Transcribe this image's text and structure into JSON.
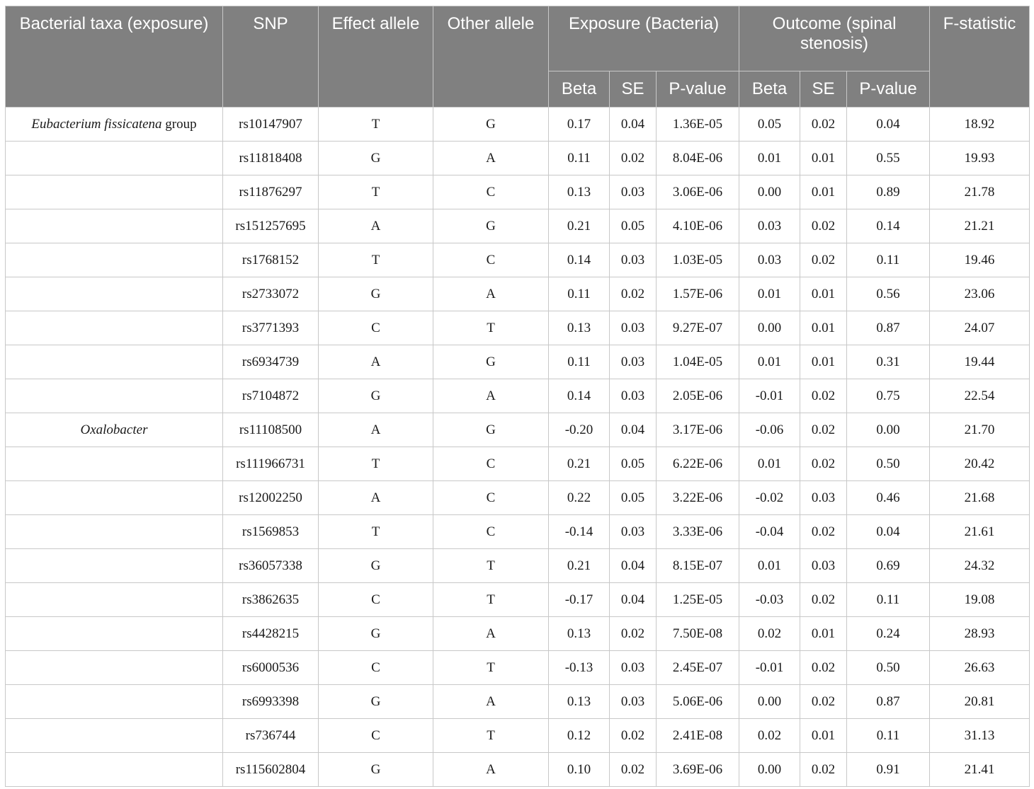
{
  "headers": {
    "taxa": "Bacterial taxa (exposure)",
    "snp": "SNP",
    "effect_allele": "Effect allele",
    "other_allele": "Other allele",
    "exposure": "Exposure (Bacteria)",
    "outcome": "Outcome (spinal stenosis)",
    "fstat": "F-statistic",
    "beta": "Beta",
    "se": "SE",
    "pvalue": "P-value"
  },
  "rows": [
    {
      "taxon_italic": "Eubacterium fissicatena",
      "taxon_suffix": " group",
      "snp": "rs10147907",
      "ea": "T",
      "oa": "G",
      "exp_beta": "0.17",
      "exp_se": "0.04",
      "exp_p": "1.36E-05",
      "out_beta": "0.05",
      "out_se": "0.02",
      "out_p": "0.04",
      "f": "18.92"
    },
    {
      "taxon_italic": "",
      "taxon_suffix": "",
      "snp": "rs11818408",
      "ea": "G",
      "oa": "A",
      "exp_beta": "0.11",
      "exp_se": "0.02",
      "exp_p": "8.04E-06",
      "out_beta": "0.01",
      "out_se": "0.01",
      "out_p": "0.55",
      "f": "19.93"
    },
    {
      "taxon_italic": "",
      "taxon_suffix": "",
      "snp": "rs11876297",
      "ea": "T",
      "oa": "C",
      "exp_beta": "0.13",
      "exp_se": "0.03",
      "exp_p": "3.06E-06",
      "out_beta": "0.00",
      "out_se": "0.01",
      "out_p": "0.89",
      "f": "21.78"
    },
    {
      "taxon_italic": "",
      "taxon_suffix": "",
      "snp": "rs151257695",
      "ea": "A",
      "oa": "G",
      "exp_beta": "0.21",
      "exp_se": "0.05",
      "exp_p": "4.10E-06",
      "out_beta": "0.03",
      "out_se": "0.02",
      "out_p": "0.14",
      "f": "21.21"
    },
    {
      "taxon_italic": "",
      "taxon_suffix": "",
      "snp": "rs1768152",
      "ea": "T",
      "oa": "C",
      "exp_beta": "0.14",
      "exp_se": "0.03",
      "exp_p": "1.03E-05",
      "out_beta": "0.03",
      "out_se": "0.02",
      "out_p": "0.11",
      "f": "19.46"
    },
    {
      "taxon_italic": "",
      "taxon_suffix": "",
      "snp": "rs2733072",
      "ea": "G",
      "oa": "A",
      "exp_beta": "0.11",
      "exp_se": "0.02",
      "exp_p": "1.57E-06",
      "out_beta": "0.01",
      "out_se": "0.01",
      "out_p": "0.56",
      "f": "23.06"
    },
    {
      "taxon_italic": "",
      "taxon_suffix": "",
      "snp": "rs3771393",
      "ea": "C",
      "oa": "T",
      "exp_beta": "0.13",
      "exp_se": "0.03",
      "exp_p": "9.27E-07",
      "out_beta": "0.00",
      "out_se": "0.01",
      "out_p": "0.87",
      "f": "24.07"
    },
    {
      "taxon_italic": "",
      "taxon_suffix": "",
      "snp": "rs6934739",
      "ea": "A",
      "oa": "G",
      "exp_beta": "0.11",
      "exp_se": "0.03",
      "exp_p": "1.04E-05",
      "out_beta": "0.01",
      "out_se": "0.01",
      "out_p": "0.31",
      "f": "19.44"
    },
    {
      "taxon_italic": "",
      "taxon_suffix": "",
      "snp": "rs7104872",
      "ea": "G",
      "oa": "A",
      "exp_beta": "0.14",
      "exp_se": "0.03",
      "exp_p": "2.05E-06",
      "out_beta": "-0.01",
      "out_se": "0.02",
      "out_p": "0.75",
      "f": "22.54"
    },
    {
      "taxon_italic": "Oxalobacter",
      "taxon_suffix": "",
      "snp": "rs11108500",
      "ea": "A",
      "oa": "G",
      "exp_beta": "-0.20",
      "exp_se": "0.04",
      "exp_p": "3.17E-06",
      "out_beta": "-0.06",
      "out_se": "0.02",
      "out_p": "0.00",
      "f": "21.70"
    },
    {
      "taxon_italic": "",
      "taxon_suffix": "",
      "snp": "rs111966731",
      "ea": "T",
      "oa": "C",
      "exp_beta": "0.21",
      "exp_se": "0.05",
      "exp_p": "6.22E-06",
      "out_beta": "0.01",
      "out_se": "0.02",
      "out_p": "0.50",
      "f": "20.42"
    },
    {
      "taxon_italic": "",
      "taxon_suffix": "",
      "snp": "rs12002250",
      "ea": "A",
      "oa": "C",
      "exp_beta": "0.22",
      "exp_se": "0.05",
      "exp_p": "3.22E-06",
      "out_beta": "-0.02",
      "out_se": "0.03",
      "out_p": "0.46",
      "f": "21.68"
    },
    {
      "taxon_italic": "",
      "taxon_suffix": "",
      "snp": "rs1569853",
      "ea": "T",
      "oa": "C",
      "exp_beta": "-0.14",
      "exp_se": "0.03",
      "exp_p": "3.33E-06",
      "out_beta": "-0.04",
      "out_se": "0.02",
      "out_p": "0.04",
      "f": "21.61"
    },
    {
      "taxon_italic": "",
      "taxon_suffix": "",
      "snp": "rs36057338",
      "ea": "G",
      "oa": "T",
      "exp_beta": "0.21",
      "exp_se": "0.04",
      "exp_p": "8.15E-07",
      "out_beta": "0.01",
      "out_se": "0.03",
      "out_p": "0.69",
      "f": "24.32"
    },
    {
      "taxon_italic": "",
      "taxon_suffix": "",
      "snp": "rs3862635",
      "ea": "C",
      "oa": "T",
      "exp_beta": "-0.17",
      "exp_se": "0.04",
      "exp_p": "1.25E-05",
      "out_beta": "-0.03",
      "out_se": "0.02",
      "out_p": "0.11",
      "f": "19.08"
    },
    {
      "taxon_italic": "",
      "taxon_suffix": "",
      "snp": "rs4428215",
      "ea": "G",
      "oa": "A",
      "exp_beta": "0.13",
      "exp_se": "0.02",
      "exp_p": "7.50E-08",
      "out_beta": "0.02",
      "out_se": "0.01",
      "out_p": "0.24",
      "f": "28.93"
    },
    {
      "taxon_italic": "",
      "taxon_suffix": "",
      "snp": "rs6000536",
      "ea": "C",
      "oa": "T",
      "exp_beta": "-0.13",
      "exp_se": "0.03",
      "exp_p": "2.45E-07",
      "out_beta": "-0.01",
      "out_se": "0.02",
      "out_p": "0.50",
      "f": "26.63"
    },
    {
      "taxon_italic": "",
      "taxon_suffix": "",
      "snp": "rs6993398",
      "ea": "G",
      "oa": "A",
      "exp_beta": "0.13",
      "exp_se": "0.03",
      "exp_p": "5.06E-06",
      "out_beta": "0.00",
      "out_se": "0.02",
      "out_p": "0.87",
      "f": "20.81"
    },
    {
      "taxon_italic": "",
      "taxon_suffix": "",
      "snp": "rs736744",
      "ea": "C",
      "oa": "T",
      "exp_beta": "0.12",
      "exp_se": "0.02",
      "exp_p": "2.41E-08",
      "out_beta": "0.02",
      "out_se": "0.01",
      "out_p": "0.11",
      "f": "31.13"
    },
    {
      "taxon_italic": "",
      "taxon_suffix": "",
      "snp": "rs115602804",
      "ea": "G",
      "oa": "A",
      "exp_beta": "0.10",
      "exp_se": "0.02",
      "exp_p": "3.69E-06",
      "out_beta": "0.00",
      "out_se": "0.02",
      "out_p": "0.91",
      "f": "21.41"
    }
  ]
}
